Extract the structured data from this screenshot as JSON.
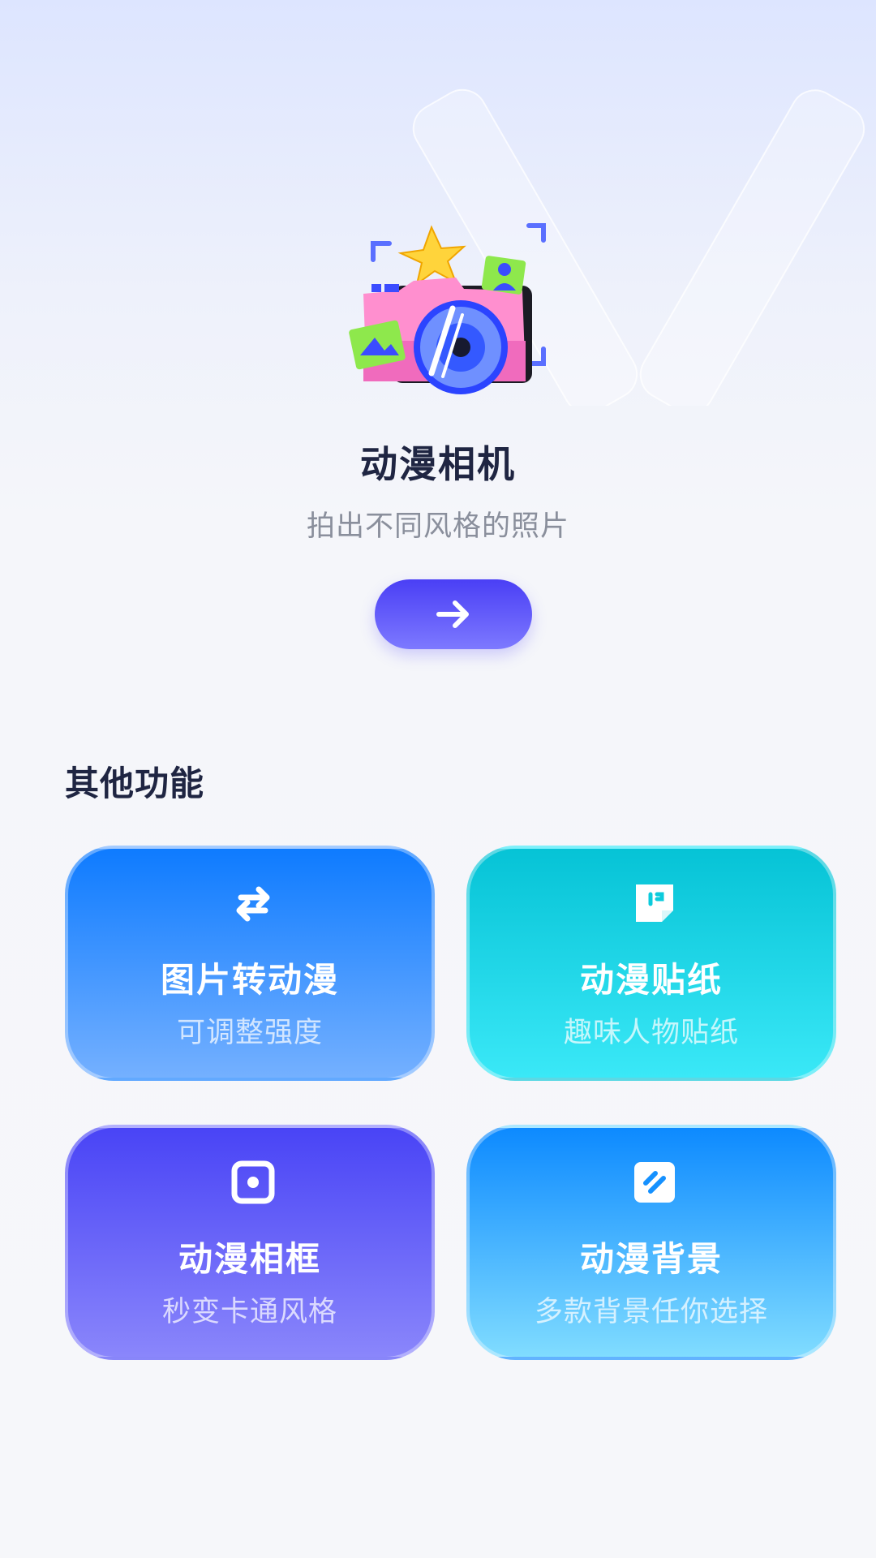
{
  "hero": {
    "title": "动漫相机",
    "subtitle": "拍出不同风格的照片",
    "start_button_icon": "arrow-right-icon"
  },
  "features": {
    "section_title": "其他功能",
    "cards": [
      {
        "title": "图片转动漫",
        "desc": "可调整强度",
        "icon": "swap-arrows-icon",
        "colors": [
          "#0e7bff",
          "#74b0ff"
        ]
      },
      {
        "title": "动漫贴纸",
        "desc": "趣味人物贴纸",
        "icon": "sticker-icon",
        "colors": [
          "#06c3d6",
          "#3ae8f7"
        ]
      },
      {
        "title": "动漫相框",
        "desc": "秒变卡通风格",
        "icon": "frame-icon",
        "colors": [
          "#4944f6",
          "#8a86fb"
        ]
      },
      {
        "title": "动漫背景",
        "desc": "多款背景任你选择",
        "icon": "background-icon",
        "colors": [
          "#0d8aff",
          "#80dcff"
        ]
      }
    ]
  },
  "colors": {
    "accent": "#4a3ff5",
    "title_text": "#1f2542",
    "subtitle_text": "#8a8f9c"
  }
}
